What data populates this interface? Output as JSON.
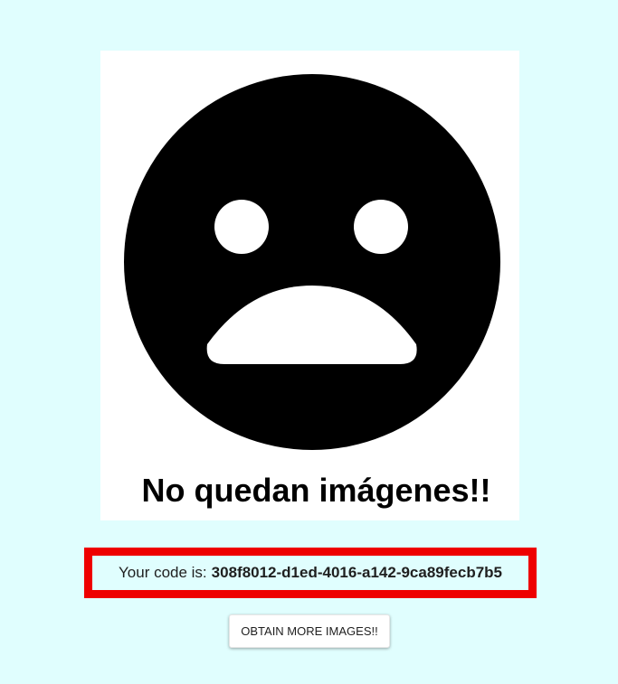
{
  "image_card": {
    "icon": "sad-face-icon",
    "message": "No quedan imágenes!!"
  },
  "code_panel": {
    "label": "Your code is:",
    "code": "308f8012-d1ed-4016-a142-9ca89fecb7b5",
    "border_color": "#ee0000"
  },
  "actions": {
    "obtain_more_label": "OBTAIN MORE IMAGES!!"
  },
  "colors": {
    "background": "#e0fefe",
    "card": "#ffffff"
  }
}
